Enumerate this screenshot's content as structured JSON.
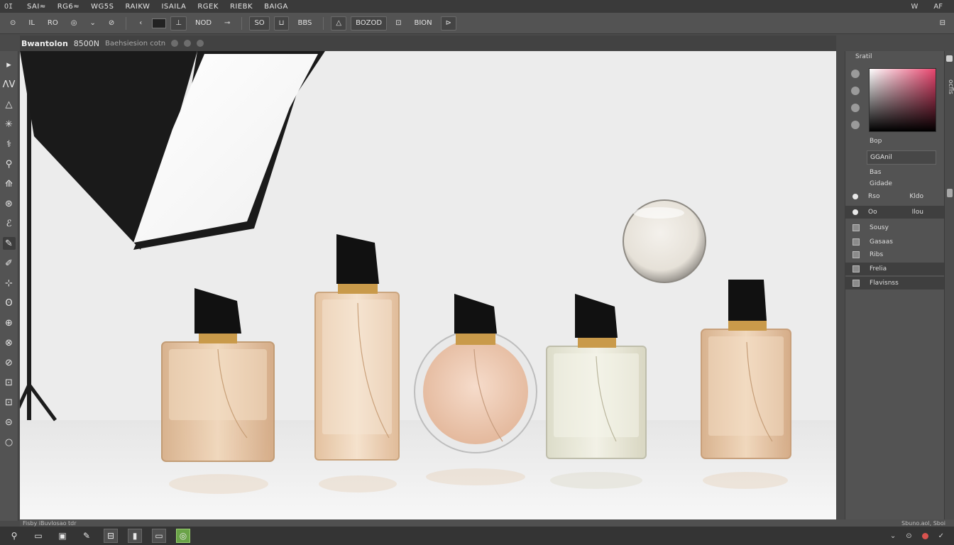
{
  "menubar": {
    "logo": "OI",
    "items": [
      "SAI≈",
      "RG6≈",
      "WG5S",
      "RAIKW",
      "ISAILA",
      "RGEK",
      "RIEBK",
      "BAIGA"
    ],
    "right_items": [
      "W",
      "AF"
    ]
  },
  "options": {
    "items": [
      "⊙",
      "IL",
      "RO",
      "◎",
      "⌄",
      "⊘",
      "‹",
      "▭",
      "⊥",
      "NOD",
      "⊸",
      "SO",
      "⊔",
      "BBS",
      "△",
      "BOZOD",
      "⊡",
      "BION",
      "⊳"
    ],
    "far_icon": "⊟"
  },
  "document": {
    "title": "Bwantolon",
    "size": "8500N",
    "subtitle": "Baehsiesion cotn"
  },
  "tools": [
    "▸",
    "ɅV",
    "△",
    "✳",
    "⚕",
    "⚲",
    "⟰",
    "⊛",
    "ℰ",
    "✎",
    "✐",
    "⊹",
    "ʘ",
    "⊕",
    "⊗",
    "⊘",
    "⊡",
    "⊡",
    "⊝",
    "○"
  ],
  "rpanel": {
    "head": "Sratil",
    "label_1": "Bop",
    "field_1": "GGAnil",
    "row_2": "Bas",
    "row_3": "Gidade",
    "layers": [
      {
        "name": "Rso",
        "extra": "Kldo",
        "bullet": "dot"
      },
      {
        "name": "Oo",
        "extra": "Ilou",
        "bullet": "dot"
      },
      {
        "name": "Sousy",
        "extra": "",
        "bullet": "sq"
      },
      {
        "name": "Gasaas",
        "extra": "",
        "bullet": "sq"
      },
      {
        "name": "Ribs",
        "extra": "",
        "bullet": "sq"
      },
      {
        "name": "Frelia",
        "extra": "",
        "bullet": "sq"
      },
      {
        "name": "Flavisnss",
        "extra": "",
        "bullet": "sq"
      }
    ]
  },
  "rstrip": {
    "vertical_text": "ocfls"
  },
  "status": {
    "left": "Fisby iBuvIosao tdr",
    "right": "Sbuno.aol, Sboi"
  },
  "taskbar": {
    "items": [
      "⚲",
      "▭",
      "▣",
      "✎",
      "⊟",
      "▮",
      "▭",
      "◎"
    ],
    "tray": [
      "⌄",
      "⊙",
      "✓"
    ]
  },
  "colors": {
    "canvas_bg": "#efefef",
    "bottle_amber": "#e9c7a2",
    "bottle_pale": "#e9e7d6",
    "cap": "#111111",
    "collar": "#c99a4a"
  }
}
